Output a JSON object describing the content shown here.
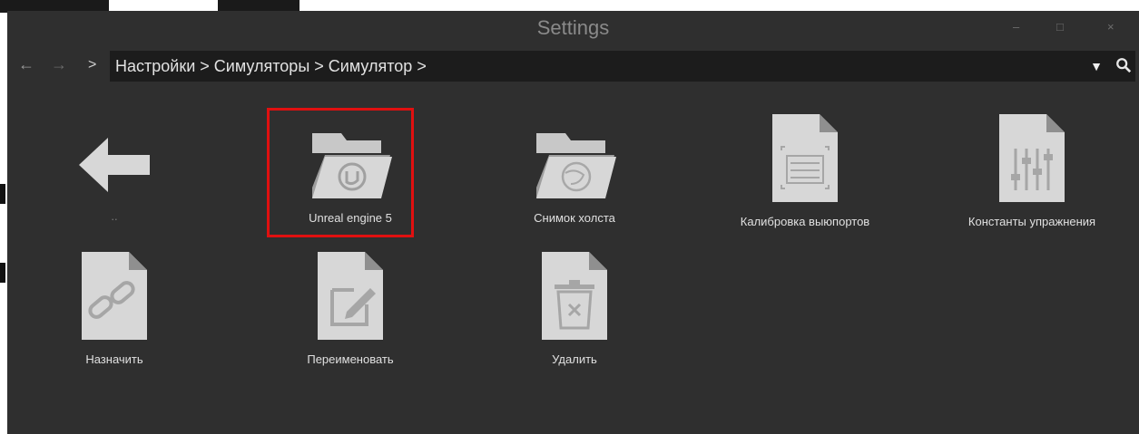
{
  "window": {
    "title": "Settings"
  },
  "window_buttons": {
    "minimize": "–",
    "maximize": "□",
    "close": "×"
  },
  "nav": {
    "back": "←",
    "forward": "→",
    "separator": ">",
    "path": "Настройки > Симуляторы > Симулятор >",
    "dropdown": "▼"
  },
  "items": [
    {
      "label": "..",
      "icon": "back-arrow-icon"
    },
    {
      "label": "Unreal engine 5",
      "icon": "unreal-folder-icon",
      "selected": true
    },
    {
      "label": "Снимок холста",
      "icon": "folder-icon"
    },
    {
      "label": "Калибровка выюпортов",
      "icon": "calibration-file-icon"
    },
    {
      "label": "Константы упражнения",
      "icon": "sliders-file-icon"
    },
    {
      "label": "Назначить",
      "icon": "link-file-icon"
    },
    {
      "label": "Переименовать",
      "icon": "edit-file-icon"
    },
    {
      "label": "Удалить",
      "icon": "trash-file-icon"
    }
  ],
  "colors": {
    "background": "#2f2f2f",
    "address_bar": "#1c1c1c",
    "icon": "#d7d7d7",
    "selection": "#e01010"
  }
}
